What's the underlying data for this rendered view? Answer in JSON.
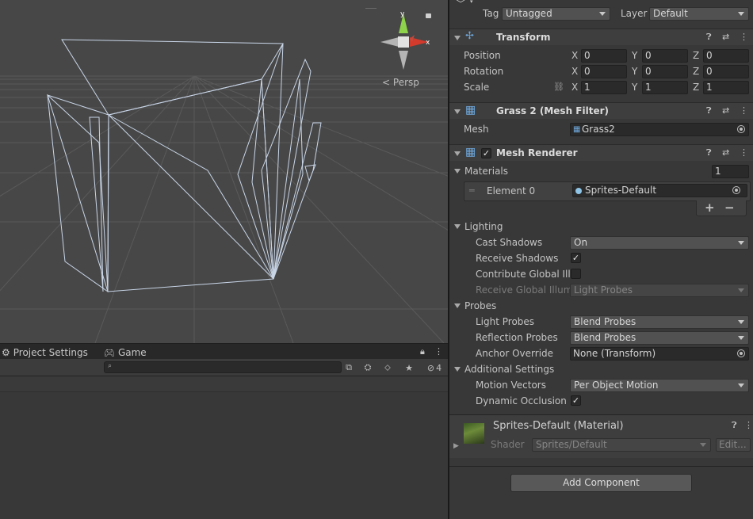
{
  "scene": {
    "view_label": "Persp",
    "gizmo_y": "y",
    "gizmo_x": "x"
  },
  "bottom_panel": {
    "tabs": [
      {
        "label": "Project Settings",
        "icon": "gear-icon"
      },
      {
        "label": "Game",
        "icon": "gamepad-icon"
      }
    ],
    "search_placeholder": "",
    "hidden_count": "4"
  },
  "inspector": {
    "tag_label": "Tag",
    "tag_value": "Untagged",
    "layer_label": "Layer",
    "layer_value": "Default",
    "transform": {
      "title": "Transform",
      "position": {
        "label": "Position",
        "x": "0",
        "y": "0",
        "z": "0"
      },
      "rotation": {
        "label": "Rotation",
        "x": "0",
        "y": "0",
        "z": "0"
      },
      "scale": {
        "label": "Scale",
        "x": "1",
        "y": "1",
        "z": "1"
      },
      "axis_x": "X",
      "axis_y": "Y",
      "axis_z": "Z"
    },
    "mesh_filter": {
      "title": "Grass 2 (Mesh Filter)",
      "mesh_label": "Mesh",
      "mesh_value": "Grass2"
    },
    "mesh_renderer": {
      "title": "Mesh Renderer",
      "materials_label": "Materials",
      "materials_count": "1",
      "element_label": "Element 0",
      "element_value": "Sprites-Default",
      "plus": "+",
      "minus": "−",
      "lighting_label": "Lighting",
      "cast_shadows_label": "Cast Shadows",
      "cast_shadows_value": "On",
      "receive_shadows_label": "Receive Shadows",
      "contribute_gi_label": "Contribute Global Illu",
      "receive_gi_label": "Receive Global Illumi",
      "receive_gi_value": "Light Probes",
      "probes_label": "Probes",
      "light_probes_label": "Light Probes",
      "light_probes_value": "Blend Probes",
      "reflection_probes_label": "Reflection Probes",
      "reflection_probes_value": "Blend Probes",
      "anchor_override_label": "Anchor Override",
      "anchor_override_value": "None (Transform)",
      "additional_label": "Additional Settings",
      "motion_vectors_label": "Motion Vectors",
      "motion_vectors_value": "Per Object Motion",
      "dynamic_occlusion_label": "Dynamic Occlusion"
    },
    "material": {
      "title": "Sprites-Default (Material)",
      "shader_label": "Shader",
      "shader_value": "Sprites/Default",
      "edit_label": "Edit..."
    },
    "add_component": "Add Component"
  },
  "colors": {
    "accent_checkbox": "#e6e6e6",
    "gizmo_x": "#d23a2c",
    "gizmo_y": "#8ed14a",
    "wireframe": "#c9d6e8"
  }
}
